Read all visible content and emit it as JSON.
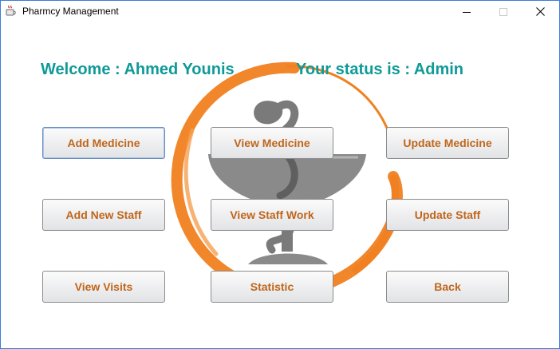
{
  "window": {
    "title": "Pharmcy Management"
  },
  "header": {
    "welcome": "Welcome : Ahmed Younis",
    "status": "Your status is : Admin"
  },
  "buttons": {
    "add_medicine": "Add Medicine",
    "view_medicine": "View Medicine",
    "update_medicine": "Update Medicine",
    "add_staff": "Add New Staff",
    "view_staff_work": "View Staff Work",
    "update_staff": "Update Staff",
    "view_visits": "View Visits",
    "statistic": "Statistic",
    "back": "Back"
  },
  "colors": {
    "heading": "#0e9a98",
    "button_text": "#c0661a",
    "logo_ring": "#f08020",
    "logo_symbol": "#7a7a7a"
  },
  "icons": {
    "app": "java-cup-icon",
    "logo": "bowl-of-hygieia-logo"
  }
}
